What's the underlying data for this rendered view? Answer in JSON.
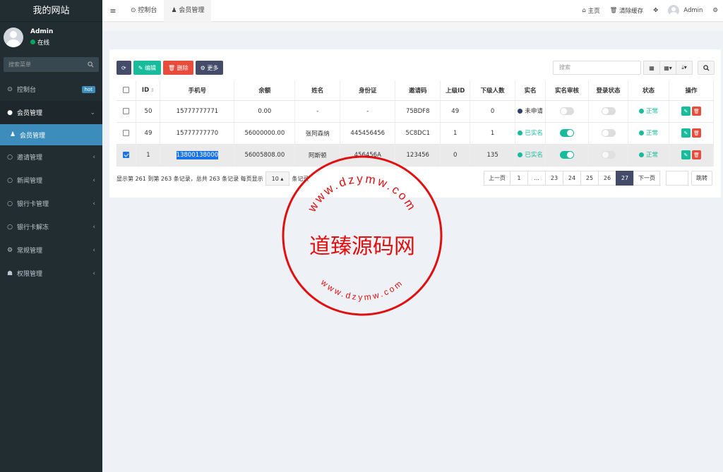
{
  "sidebar": {
    "site_title": "我的网站",
    "user": {
      "name": "Admin",
      "status": "在线"
    },
    "search_placeholder": "搜索菜单",
    "menu": [
      {
        "icon": "dashboard-icon",
        "glyph": "⊙",
        "label": "控制台",
        "badge": "hot"
      },
      {
        "icon": "user-circle-icon",
        "glyph": "●",
        "label": "会员管理",
        "arrow": "⌄"
      },
      {
        "icon": "user-icon",
        "glyph": "♟",
        "label": "会员管理"
      },
      {
        "icon": "circle-icon",
        "glyph": "○",
        "label": "邀请管理",
        "arrow": "‹"
      },
      {
        "icon": "circle-icon",
        "glyph": "○",
        "label": "新闻管理",
        "arrow": "‹"
      },
      {
        "icon": "circle-icon",
        "glyph": "○",
        "label": "银行卡管理",
        "arrow": "‹"
      },
      {
        "icon": "circle-icon",
        "glyph": "○",
        "label": "银行卡解冻",
        "arrow": "‹"
      },
      {
        "icon": "cogs-icon",
        "glyph": "⚙",
        "label": "常规管理",
        "arrow": "‹"
      },
      {
        "icon": "group-icon",
        "glyph": "☗",
        "label": "权限管理",
        "arrow": "‹"
      }
    ]
  },
  "topbar": {
    "tabs": [
      {
        "label": "控制台",
        "glyph": "⊙"
      },
      {
        "label": "会员管理",
        "glyph": "♟"
      }
    ],
    "home": "主页",
    "clear_cache": "清除缓存",
    "admin": "Admin"
  },
  "toolbar": {
    "edit": "编辑",
    "delete": "删除",
    "more": "更多",
    "search_placeholder": "搜索"
  },
  "table": {
    "headers": [
      "ID",
      "手机号",
      "余额",
      "姓名",
      "身份证",
      "邀请码",
      "上级ID",
      "下级人数",
      "实名",
      "实名审核",
      "登录状态",
      "状态",
      "操作"
    ],
    "rows": [
      {
        "checked": false,
        "id": "50",
        "phone": "15777777771",
        "balance": "0.00",
        "name": "-",
        "idcard": "-",
        "invite": "75BDF8",
        "parent": "49",
        "children": "0",
        "realname": "未申请",
        "realname_state": "none",
        "audit": false,
        "login": false,
        "status": "正常"
      },
      {
        "checked": false,
        "id": "49",
        "phone": "15777777770",
        "balance": "56000000.00",
        "name": "张阿森纳",
        "idcard": "445456456",
        "invite": "5C8DC1",
        "parent": "1",
        "children": "1",
        "realname": "已实名",
        "realname_state": "done",
        "audit": true,
        "login": false,
        "status": "正常"
      },
      {
        "checked": true,
        "id": "1",
        "phone": "13800138000",
        "balance": "56005808.00",
        "name": "阿斯顿",
        "idcard": "456456A",
        "invite": "123456",
        "parent": "0",
        "children": "135",
        "realname": "已实名",
        "realname_state": "done",
        "audit": true,
        "login": false,
        "status": "正常"
      }
    ]
  },
  "pager": {
    "info_prefix": "显示第 261 到第 263 条记录，总共 263 条记录 每页显示",
    "page_size": "10",
    "info_suffix": "条记录",
    "prev": "上一页",
    "pages": [
      "1",
      "...",
      "23",
      "24",
      "25",
      "26",
      "27"
    ],
    "active_page": "27",
    "next": "下一页",
    "go": "跳转"
  },
  "watermark": {
    "center_text": "道臻源码网",
    "ring_top": "www.dzymw.com",
    "ring_bottom": "www.dzymw.com",
    "color": "#e01010"
  }
}
